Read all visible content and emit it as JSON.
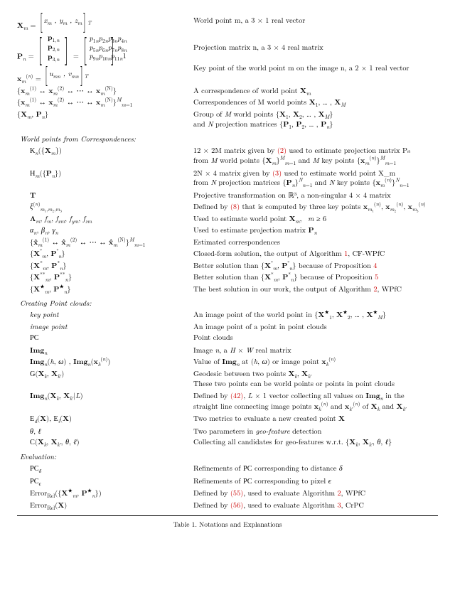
{
  "sym": {
    "Xm": "X",
    "xm": "x",
    "ym": "y",
    "zm": "z",
    "Pn": "P",
    "p": "p",
    "xmn": "x",
    "u": "u",
    "v": "v",
    "corr1": "x",
    "corr_m": "X",
    "Kn": "𝒦",
    "Hm": "ℋ",
    "T": "T",
    "xi": "ξ",
    "Lam": "Λ",
    "f": "f",
    "alpha": "α",
    "beta": "β",
    "gamma": "γ",
    "hat": "x̂",
    "circ": "°",
    "star": "*",
    "dstar": "**",
    "bstar": "★",
    "key": "key point",
    "img": "image point",
    "PC": "𝒫𝒞",
    "Img": "Img",
    "G": "𝒢",
    "Ed": "ℰ",
    "Ei": "ℰ",
    "theta": "θ",
    "ell": "ℓ",
    "C": "𝒞",
    "PCd": "𝒫𝒞",
    "PCe": "𝒫𝒞",
    "Err": "Error"
  },
  "desc": {
    "Xm": "World point m, a 3 × 1 real vector",
    "Pn": "Projection matrix n, a 3 × 4 real matrix",
    "xmn": "Key point of the world point m on the image n, a 2 × 1 real vector",
    "corr1": "A correspondence of world point ",
    "corr1b": "X",
    "corrM1": "Correspondences of M world points ",
    "corrM2": "X₁, … , X_M",
    "group1": "Group of M world points {X₁, X₂, … , X_M}",
    "group2": "and N projection matrices {P₁, P₂, … , Pₙ}",
    "sec1": "World points from Correspondences:",
    "Kn1": "12 × 2M matrix given by ",
    "Kn_ref": "(2)",
    "Kn2": " used to estimate projection matrix Pₙ",
    "Kn3": "from M world points {X_m}ᴹₘ₌₁ and M key points {x_m⁽ⁿ⁾}ᴹₘ₌₁",
    "Hm1": "2N × 4 matrix given by ",
    "Hm_ref": "(3)",
    "Hm2": " used to estimate world point X_m",
    "Hm3": "from N projection matrices {Pₙ}ᴺₙ₌₁ and N key points {x_m⁽ⁿ⁾}ᴺₙ₌₁",
    "T": "Projective transformation on ℝ³, a non-singular 4 × 4 matrix",
    "xi1": "Defined by ",
    "xi_ref": "(8)",
    "xi2": " that is computed by three key points x_{m₁}⁽ⁿ⁾, x_{m₂}⁽ⁿ⁾, x_{m₃}⁽ⁿ⁾",
    "Lam": "Used to estimate world point X_m,  m ≥ 6",
    "abg": "Used to estimate projection matrix Pₙ",
    "hat": "Estimated correspondences",
    "circ1": "Closed-form solution, the output of Algorithm ",
    "circ_a": "1",
    "circ2": ", CF-WPfC",
    "star1": "Better solution than {X°_m, P°_n} because of Proposition ",
    "star_r": "4",
    "dstar1": "Better solution than {X*_m, P*_n} because of Proposition ",
    "dstar_r": "5",
    "best1": "The best solution in our work, the output of Algorithm ",
    "best_a": "2",
    "best2": ", WPfC",
    "sec2": "Creating Point clouds:",
    "key": "An image point of the world point in {X★₁, X★₂, … , X★_M}",
    "imgpt": "An image point of a point in point clouds",
    "PC": "Point clouds",
    "Imgn": "Image n, a H × W real matrix",
    "Imghw": "Value of Imgₙ at (h, ω) or image point x_k⁽ⁿ⁾",
    "G1": "Geodesic between two points X_k, X_{k′}",
    "G2": "These two points can be world points or points in point clouds",
    "ImgL1": "Defined by ",
    "ImgL_ref": "(42)",
    "ImgL2": ", L × 1 vector collecting all values on Imgₙ in the",
    "ImgL3": "straight line connecting image points x_k⁽ⁿ⁾ and x_{k′}⁽ⁿ⁾ of X_k and X_{k′}",
    "EdEi": "Two metrics to evaluate a new created point X",
    "tl": "Two parameters in geo-feature detection",
    "Ccol": "Collecting all candidates for geo-features w.r.t. {X_k, X_{k′}, θ, ℓ}",
    "sec3": "Evaluation:",
    "pcd": "Refinements of 𝒫𝒞 corresponding to distance δ",
    "pce": "Refinements of 𝒫𝒞 corresponding to pixel ϵ",
    "err11": "Defined by ",
    "err1_ref": "(55)",
    "err12": ", used to evaluate Algorithm ",
    "err1_a": "2",
    "err13": ", WPfC",
    "err21": "Defined by ",
    "err2_ref": "(56)",
    "err22": ", used to evaluate Algorithm ",
    "err2_a": "3",
    "err23": ", CrPC"
  },
  "caption": "Table 1. Notations and Explanations"
}
